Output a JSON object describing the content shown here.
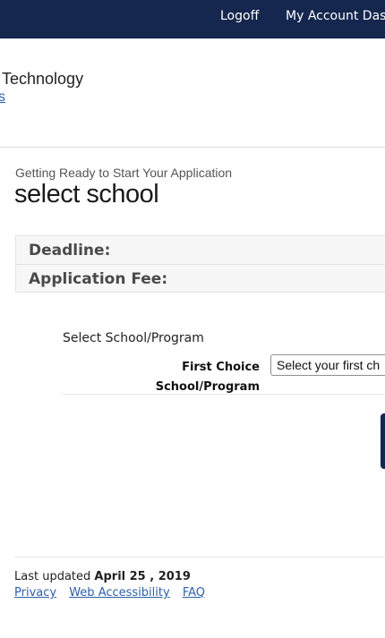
{
  "topnav": {
    "logoff": "Logoff",
    "account": "My Account Das"
  },
  "header": {
    "org_name": "Technology",
    "sub_link": "s"
  },
  "page": {
    "subtitle": "Getting Ready to Start Your Application",
    "title": "select school"
  },
  "info": {
    "deadline_label": "Deadline:",
    "fee_label": "Application Fee:"
  },
  "form": {
    "section_label": "Select School/Program",
    "first_choice_label_1": "First Choice",
    "first_choice_label_2": "School/Program",
    "first_choice_select": "Select your first ch"
  },
  "footer": {
    "last_updated_prefix": "Last updated",
    "last_updated_date": "April 25 , 2019",
    "links": [
      "Privacy",
      "Web Accessibility",
      "FAQ"
    ]
  },
  "colors": {
    "nav_bg": "#15264f",
    "link": "#2c5fa8"
  }
}
